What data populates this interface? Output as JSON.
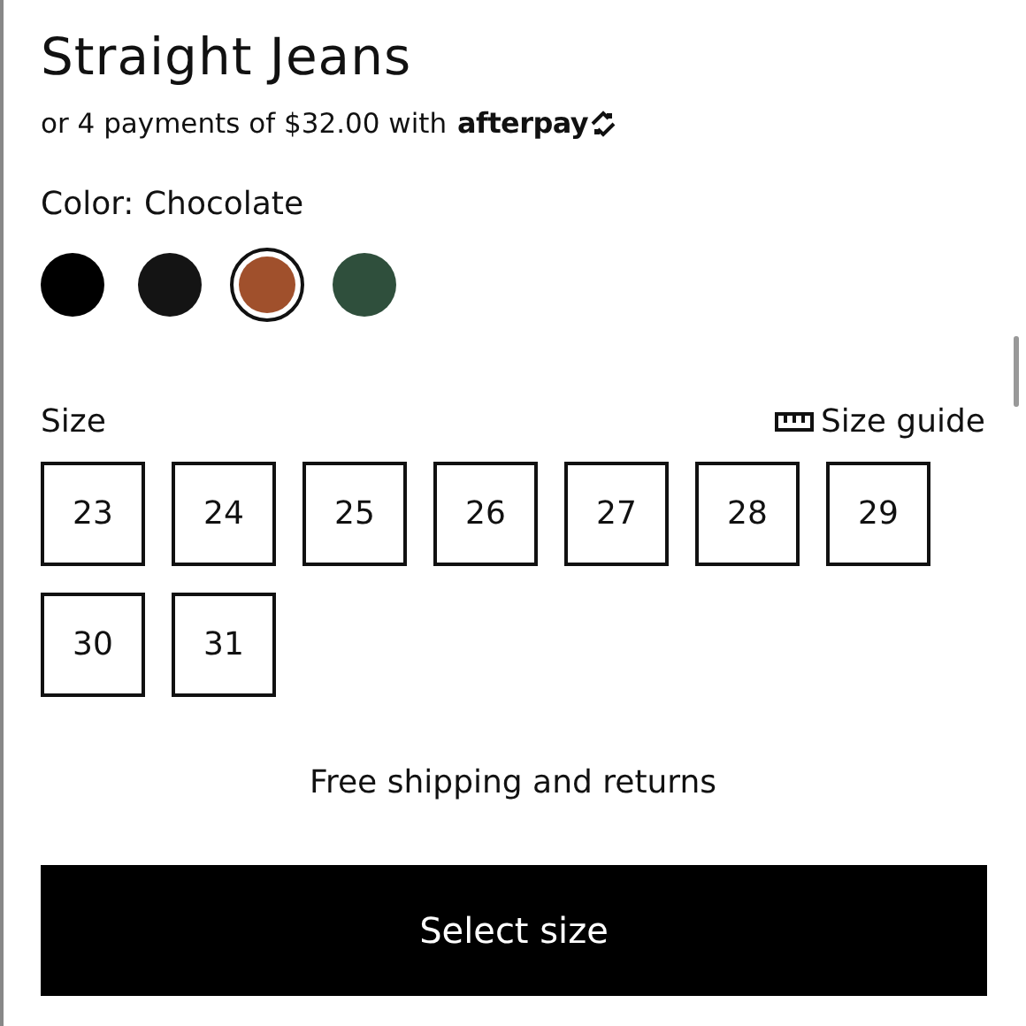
{
  "product": {
    "title": "Straight Jeans",
    "payment_text": "or 4 payments of $32.00 with",
    "payment_brand": "afterpay"
  },
  "color": {
    "label": "Color: Chocolate",
    "swatches": [
      {
        "color": "#000000",
        "selected": false
      },
      {
        "color": "#141414",
        "selected": false
      },
      {
        "color": "#a0502c",
        "selected": true
      },
      {
        "color": "#2f4f3c",
        "selected": false
      }
    ]
  },
  "size": {
    "label": "Size",
    "guide": "Size guide",
    "options": [
      {
        "label": "23",
        "selected": false
      },
      {
        "label": "24",
        "selected": false
      },
      {
        "label": "25",
        "selected": false
      },
      {
        "label": "26",
        "selected": false
      },
      {
        "label": "27",
        "selected": false
      },
      {
        "label": "28",
        "selected": false
      },
      {
        "label": "29",
        "selected": false
      },
      {
        "label": "30",
        "selected": false
      },
      {
        "label": "31",
        "selected": false
      }
    ]
  },
  "shipping_note": "Free shipping and returns",
  "button": "Select size"
}
